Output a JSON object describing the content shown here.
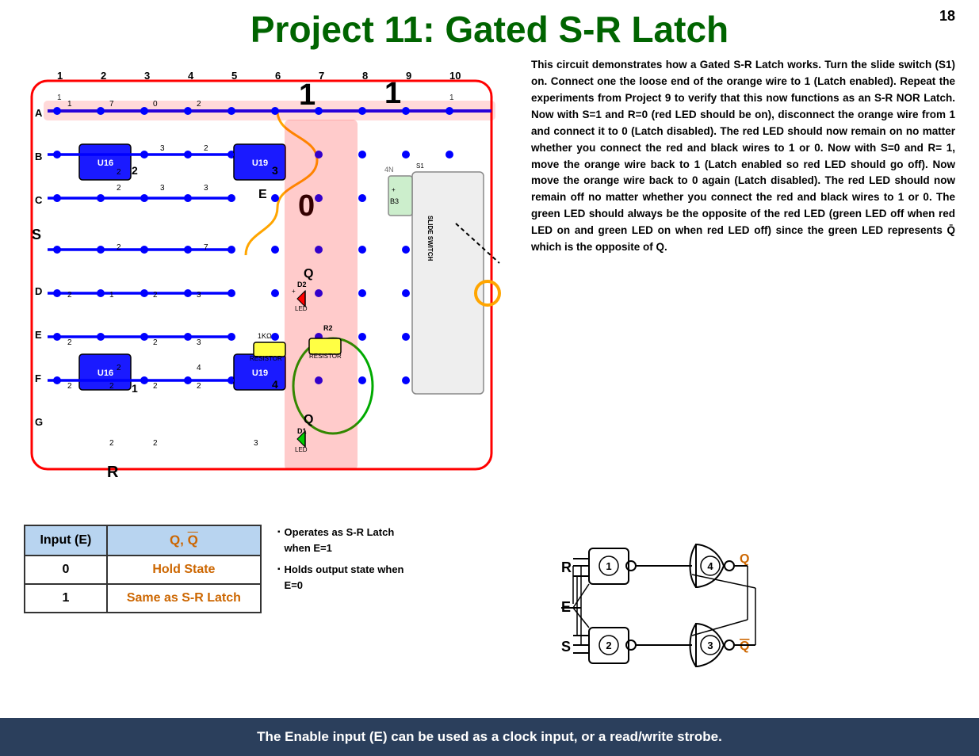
{
  "page": {
    "number": "18",
    "title_prefix": "Project 11: ",
    "title_highlight": "Gated S-R Latch"
  },
  "description": {
    "text": "This circuit demonstrates how a Gated S-R Latch works. Turn the slide switch (S1) on. Connect one the loose end of the orange wire to 1 (Latch enabled). Repeat the experiments from Project 9 to verify that this now functions as an S-R NOR Latch. Now with S=1 and R=0 (red LED should be on), disconnect the orange wire from 1 and connect it to 0 (Latch disabled). The red LED should now remain on no matter whether you connect the red and black wires to 1 or 0. Now with S=0 and R= 1, move the orange wire back to 1 (Latch enabled so red LED should go off). Now move the orange wire back to 0 again (Latch disabled). The red LED should now remain off no matter whether you connect the red and black wires to 1 or 0. The green LED should always be the opposite of the red LED (green LED off when red LED on and green LED on when red LED off) since the green LED represents Q̄ which is the opposite of Q."
  },
  "truth_table": {
    "header_col1": "Input (E)",
    "header_col2": "Q, Q̄",
    "row1_input": "0",
    "row1_output": "Hold State",
    "row2_input": "1",
    "row2_output": "Same as S-R Latch"
  },
  "bullets": {
    "item1": "Operates as S-R Latch when E=1",
    "item2": "Holds output state when E=0"
  },
  "footer": {
    "text": "The Enable input (E) can be used as a clock input, or a read/write strobe."
  }
}
